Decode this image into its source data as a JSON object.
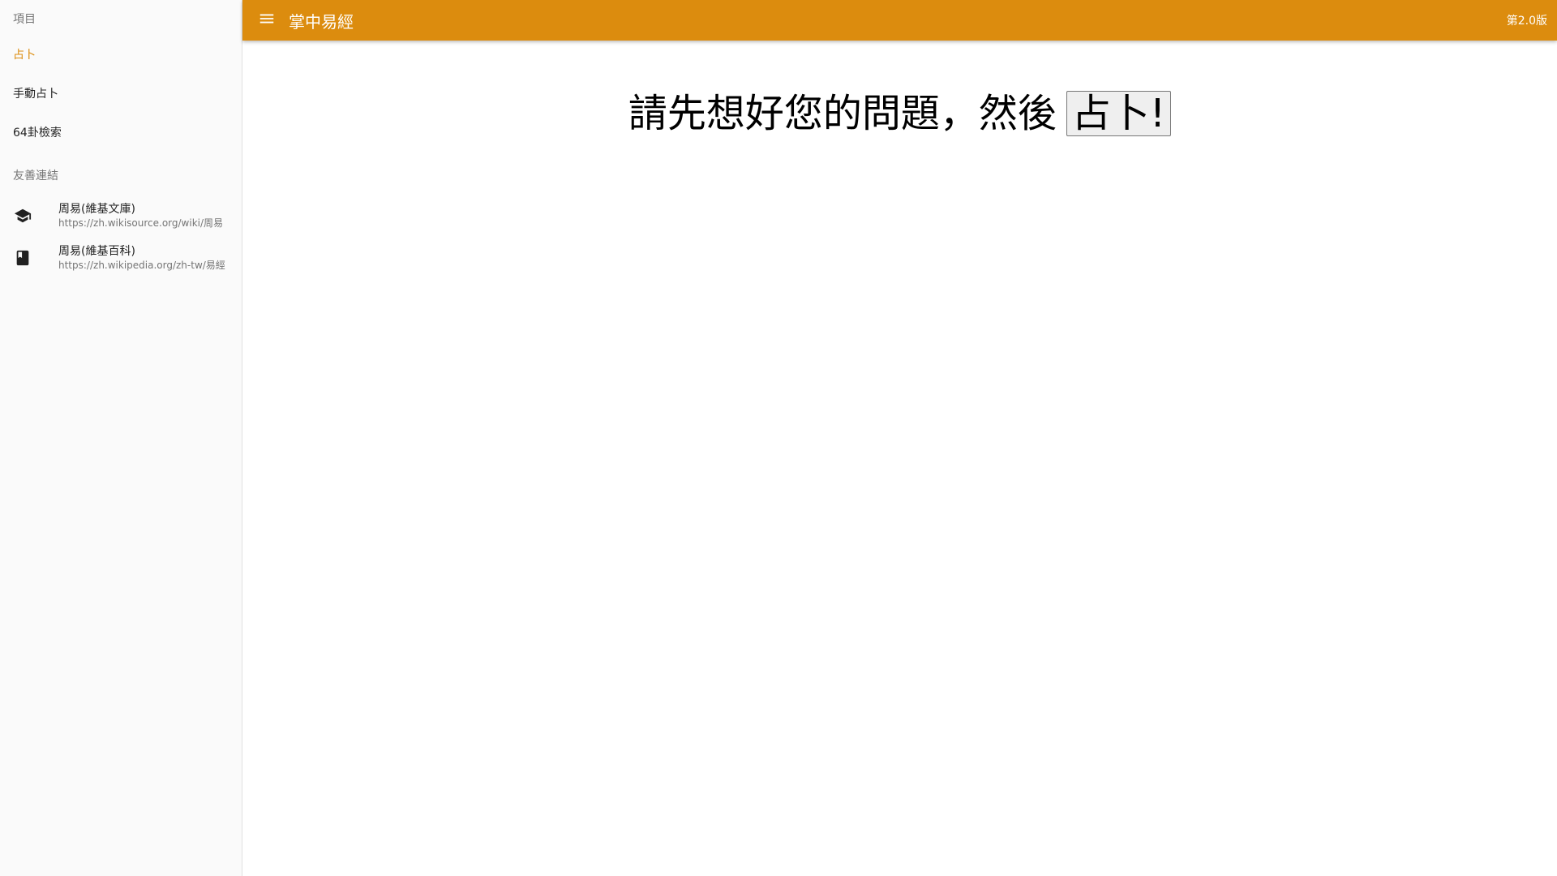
{
  "sidebar": {
    "section_items_label": "項目",
    "items": [
      {
        "label": "占卜",
        "active": true
      },
      {
        "label": "手動占卜",
        "active": false
      },
      {
        "label": "64卦檢索",
        "active": false
      }
    ],
    "section_links_label": "友善連結",
    "links": [
      {
        "title": "周易(維基文庫)",
        "url": "https://zh.wikisource.org/wiki/周易",
        "icon": "school-icon"
      },
      {
        "title": "周易(維基百科)",
        "url": "https://zh.wikipedia.org/zh-tw/易經",
        "icon": "book-icon"
      }
    ]
  },
  "topbar": {
    "title": "掌中易經",
    "version": "第2.0版",
    "menu_icon": "menu-icon"
  },
  "main": {
    "prompt": "請先想好您的問題，然後",
    "button_label": "占卜!"
  },
  "colors": {
    "accent": "#dc8c0e",
    "sidebar_bg": "#fafafa",
    "text": "#212121",
    "secondary_text": "#757575"
  }
}
